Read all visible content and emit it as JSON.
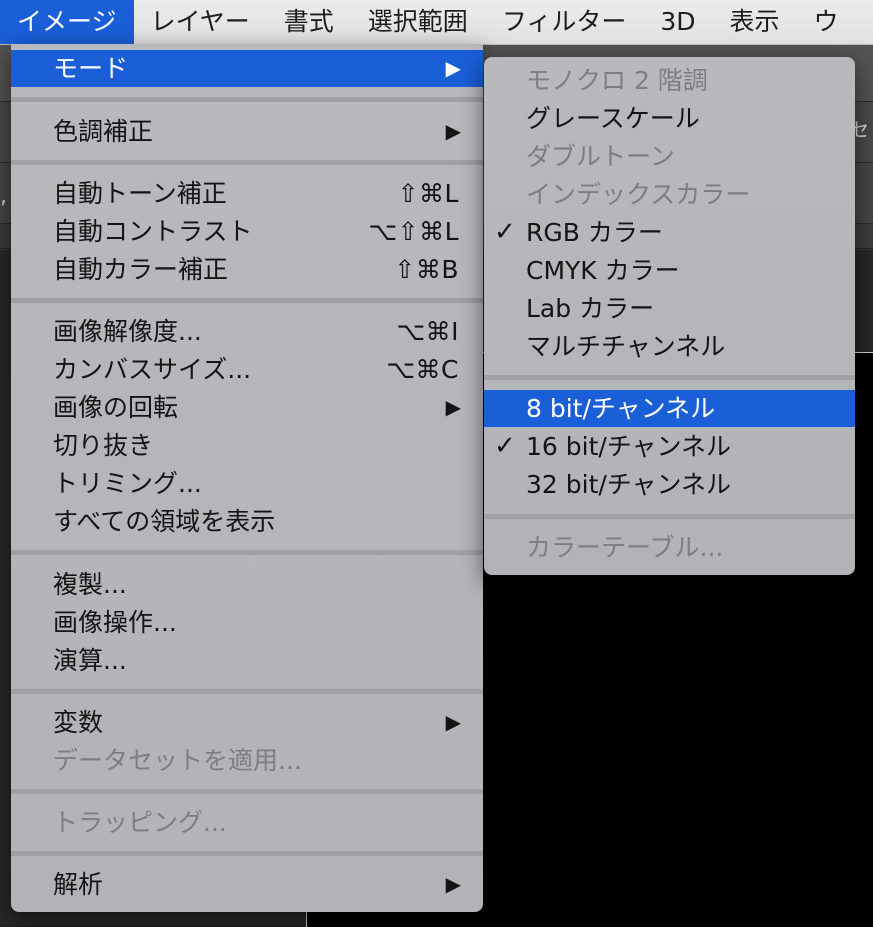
{
  "menubar": {
    "items": [
      "イメージ",
      "レイヤー",
      "書式",
      "選択範囲",
      "フィルター",
      "3D",
      "表示",
      "ウ"
    ]
  },
  "background": {
    "edge_text": "セ",
    "edge_comma": ","
  },
  "image_menu": {
    "items": [
      {
        "label": "モード",
        "submenu": true,
        "highlighted": true
      },
      {
        "label": "色調補正",
        "submenu": true
      },
      {
        "label": "自動トーン補正",
        "shortcut": "⇧⌘L"
      },
      {
        "label": "自動コントラスト",
        "shortcut": "⌥⇧⌘L"
      },
      {
        "label": "自動カラー補正",
        "shortcut": "⇧⌘B"
      },
      {
        "label": "画像解像度...",
        "shortcut": "⌥⌘I"
      },
      {
        "label": "カンバスサイズ...",
        "shortcut": "⌥⌘C"
      },
      {
        "label": "画像の回転",
        "submenu": true
      },
      {
        "label": "切り抜き"
      },
      {
        "label": "トリミング..."
      },
      {
        "label": "すべての領域を表示"
      },
      {
        "label": "複製..."
      },
      {
        "label": "画像操作..."
      },
      {
        "label": "演算..."
      },
      {
        "label": "変数",
        "submenu": true
      },
      {
        "label": "データセットを適用...",
        "disabled": true
      },
      {
        "label": "トラッピング...",
        "disabled": true
      },
      {
        "label": "解析",
        "submenu": true
      }
    ]
  },
  "mode_submenu": {
    "items": [
      {
        "label": "モノクロ 2 階調",
        "disabled": true
      },
      {
        "label": "グレースケール"
      },
      {
        "label": "ダブルトーン",
        "disabled": true
      },
      {
        "label": "インデックスカラー",
        "disabled": true
      },
      {
        "label": "RGB カラー",
        "checked": true
      },
      {
        "label": "CMYK カラー"
      },
      {
        "label": "Lab カラー"
      },
      {
        "label": "マルチチャンネル"
      },
      {
        "label": "8 bit/チャンネル",
        "highlighted": true
      },
      {
        "label": "16 bit/チャンネル",
        "checked": true
      },
      {
        "label": "32 bit/チャンネル"
      },
      {
        "label": "カラーテーブル...",
        "disabled": true
      }
    ]
  },
  "glyphs": {
    "arrow": "▶",
    "check": "✓"
  },
  "colors": {
    "highlight": "#1a5ed8",
    "menu_bg": "#b4b6ba",
    "disabled_text": "#7c7e82"
  }
}
